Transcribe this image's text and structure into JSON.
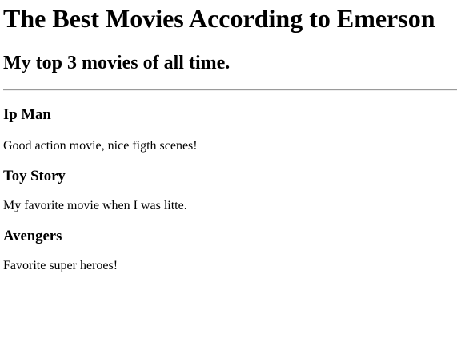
{
  "page": {
    "title": "The Best Movies According to Emerson",
    "subtitle": "My top 3 movies of all time."
  },
  "movies": [
    {
      "title": "Ip Man",
      "description": "Good action movie, nice figth scenes!"
    },
    {
      "title": "Toy Story",
      "description": "My favorite movie when I was litte."
    },
    {
      "title": "Avengers",
      "description": "Favorite super heroes!"
    }
  ]
}
